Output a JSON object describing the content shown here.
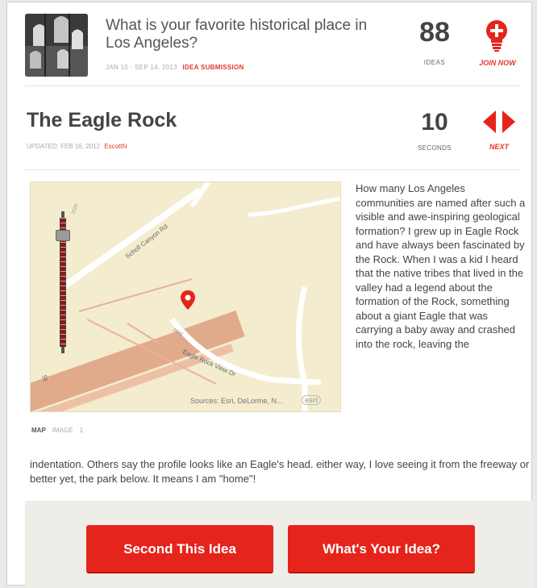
{
  "question": {
    "title": "What is your favorite historical place in Los Angeles?",
    "meta_dates": "JAN 10 - SEP 14, 2013",
    "meta_kind": "IDEA SUBMISSION",
    "ideas_count": "88",
    "ideas_label": "IDEAS",
    "join_label": "JOIN NOW",
    "join_icon": "lightbulb-plus-icon"
  },
  "idea": {
    "title": "The Eagle Rock",
    "updated": "UPDATED: FEB 16, 2012",
    "author": "EscottN",
    "seconds_count": "10",
    "seconds_label": "SECONDS",
    "next_label": "NEXT",
    "nav_icon": "prev-next-arrows-icon"
  },
  "map": {
    "road_labels": [
      "Scholl Canyon Rd",
      "Eagle Rock View Dr",
      "St",
      "2560",
      "2529"
    ],
    "attribution": "Sources: Esri, DeLorme, N...",
    "badge": "esri",
    "pin_icon": "map-pin-icon",
    "zoom_level": 0.9
  },
  "media_tabs": {
    "map_label": "MAP",
    "image_label": "IMAGE",
    "image_count": "1"
  },
  "description": {
    "side_text": "How many Los Angeles communities are named after such a visible and awe-inspiring geological formation? I grew up in Eagle Rock and have always been fascinated by the Rock. When I was a kid I heard that the native tribes that lived in the valley had a legend about the formation of the Rock, something about a giant Eagle that was carrying a baby away and crashed into the rock, leaving the",
    "full_text": "indentation. Others say the profile looks like an Eagle's head. either way, I love seeing it from the freeway or better yet, the park below. It means I am \"home\"!"
  },
  "actions": {
    "second_label": "Second This Idea",
    "your_idea_label": "What's Your Idea?"
  },
  "colors": {
    "accent": "#e5241c",
    "map_background": "#f4eccf",
    "action_bar": "#efede8"
  }
}
